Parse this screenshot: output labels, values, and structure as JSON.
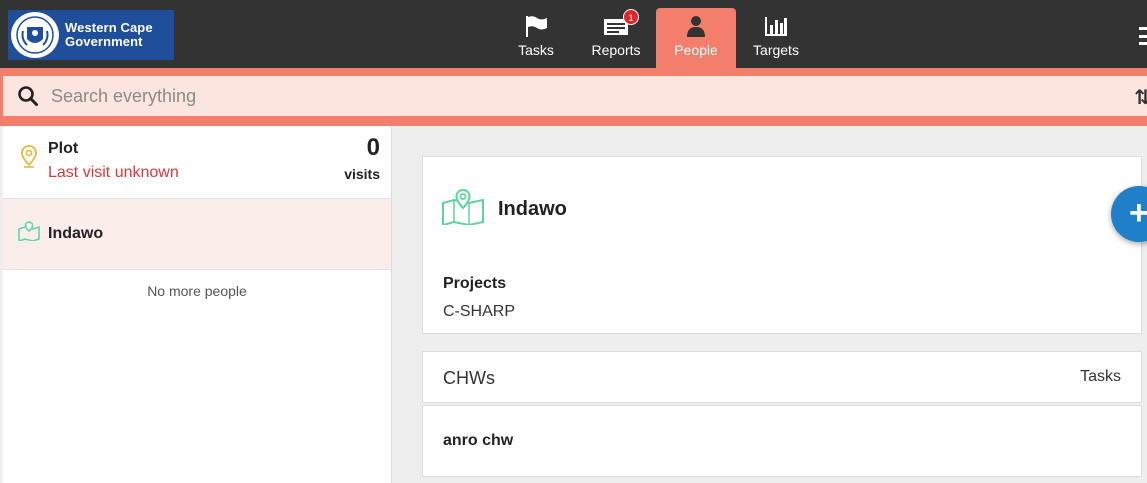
{
  "header": {
    "logo_line1": "Western Cape",
    "logo_line2": "Government",
    "tabs": [
      {
        "label": "Tasks"
      },
      {
        "label": "Reports",
        "badge": "1"
      },
      {
        "label": "People"
      },
      {
        "label": "Targets"
      }
    ],
    "active_tab": "People"
  },
  "search": {
    "placeholder": "Search everything"
  },
  "list": {
    "items": [
      {
        "title": "Plot",
        "subtitle": "Last visit unknown",
        "visits_count": "0",
        "visits_label": "visits"
      },
      {
        "title": "Indawo"
      }
    ],
    "footer": "No more people"
  },
  "detail": {
    "title": "Indawo",
    "projects_label": "Projects",
    "projects_value": "C-SHARP",
    "chw_header": "CHWs",
    "tasks_header": "Tasks",
    "chw_rows": [
      {
        "name": "anro chw"
      }
    ]
  },
  "colors": {
    "header_bg": "#333333",
    "accent": "#f47e6c",
    "search_bg": "#fce4df",
    "selected_bg": "#fbedea",
    "alert": "#d9393c",
    "fab": "#1f7fc8",
    "place_icon": "#5fd3a0"
  }
}
